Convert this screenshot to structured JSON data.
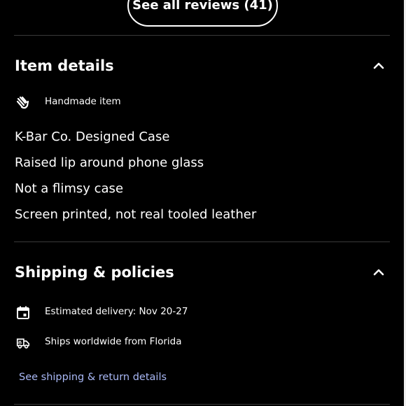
{
  "reviews": {
    "button_label": "See all reviews (41)"
  },
  "item_details": {
    "title": "Item details",
    "handmade_label": "Handmade item",
    "lines": [
      "K-Bar Co. Designed Case",
      "Raised lip around phone glass",
      "Not a flimsy case",
      "Screen printed, not real tooled leather"
    ]
  },
  "shipping": {
    "title": "Shipping & policies",
    "delivery": "Estimated delivery: Nov 20-27",
    "ships_from": "Ships worldwide from Florida",
    "link": "See shipping & return details"
  },
  "colors": {
    "background": "#000000",
    "text": "#ffffff",
    "link": "#a9b8f5",
    "divider": "#3a3a3a"
  }
}
